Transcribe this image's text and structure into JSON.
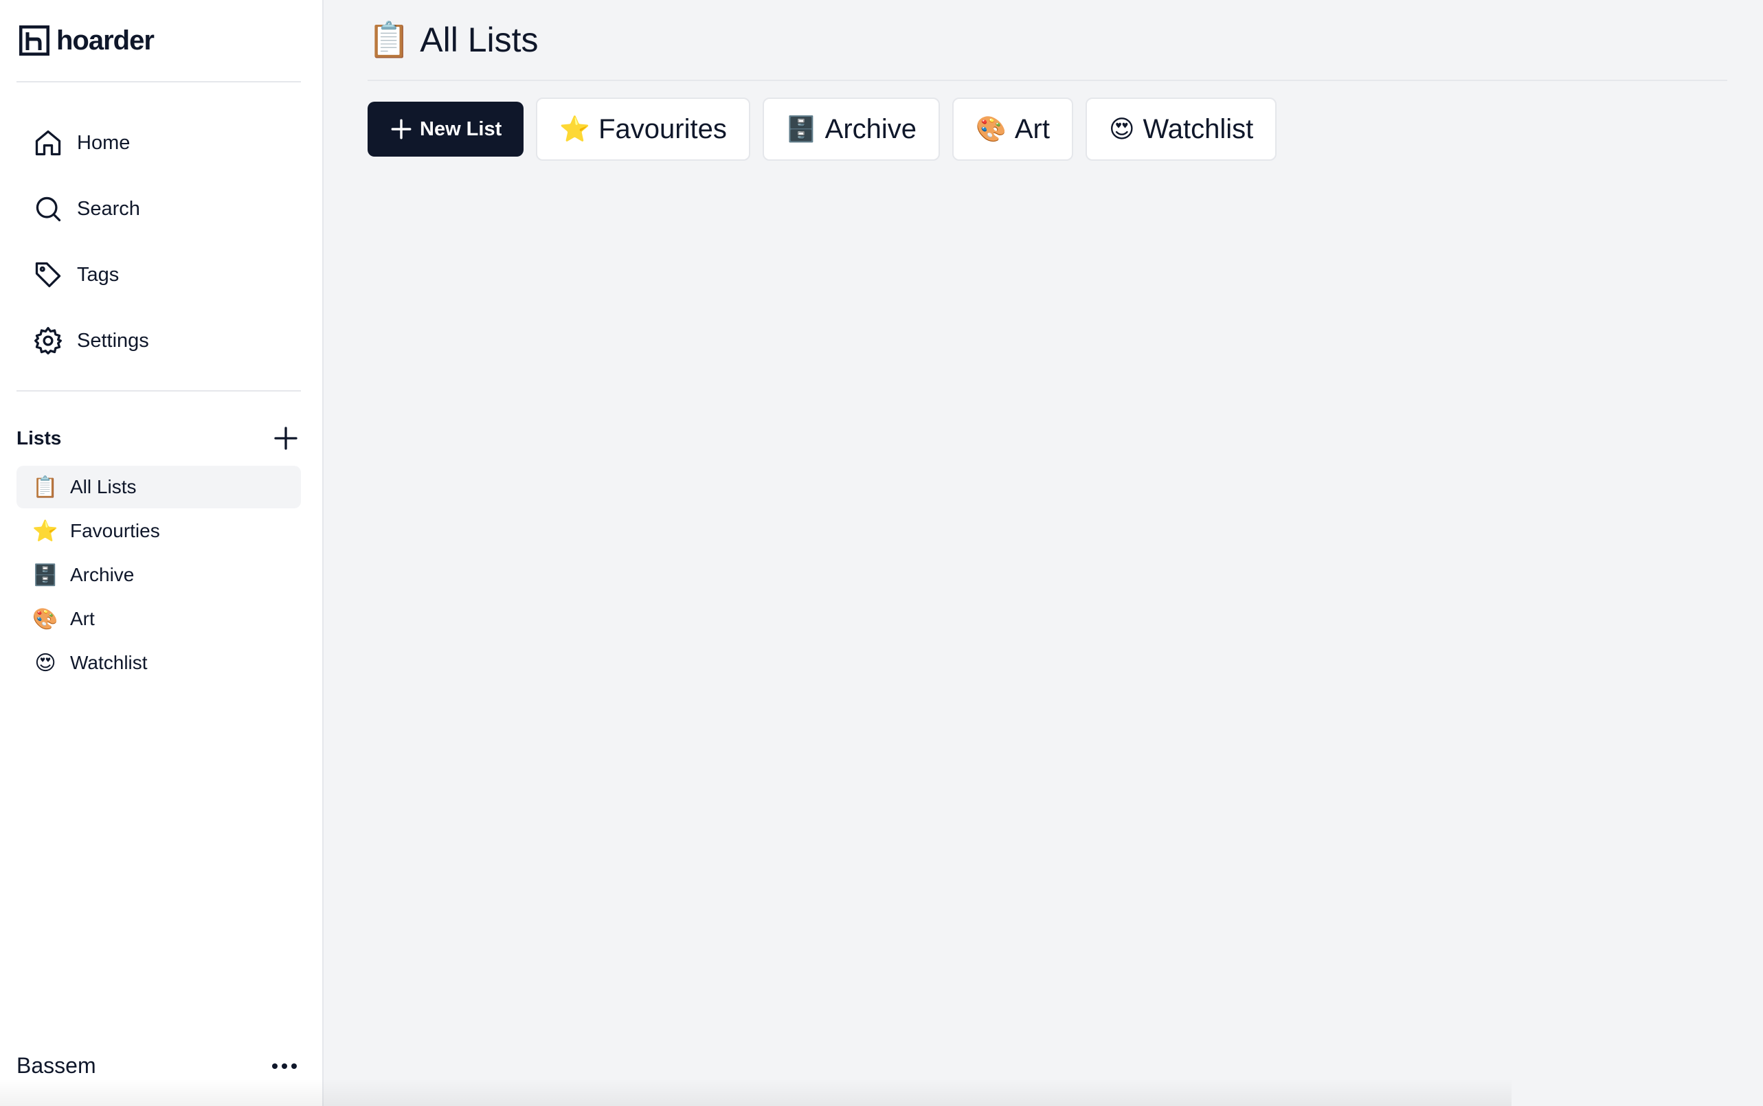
{
  "app": {
    "name": "hoarder"
  },
  "nav": [
    {
      "label": "Home",
      "icon": "home-icon"
    },
    {
      "label": "Search",
      "icon": "search-icon"
    },
    {
      "label": "Tags",
      "icon": "tag-icon"
    },
    {
      "label": "Settings",
      "icon": "gear-icon"
    }
  ],
  "lists": {
    "title": "Lists",
    "items": [
      {
        "emoji": "📋",
        "label": "All Lists",
        "active": true
      },
      {
        "emoji": "⭐️",
        "label": "Favourties"
      },
      {
        "emoji": "🗄️",
        "label": "Archive"
      },
      {
        "emoji": "🎨",
        "label": "Art"
      },
      {
        "emoji": "😍",
        "label": "Watchlist"
      }
    ]
  },
  "user": {
    "name": "Bassem"
  },
  "page": {
    "emoji": "📋",
    "title": "All Lists"
  },
  "toolbar": {
    "new_list_label": "New List",
    "chips": [
      {
        "emoji": "⭐️",
        "label": "Favourites"
      },
      {
        "emoji": "🗄️",
        "label": "Archive"
      },
      {
        "emoji": "🎨",
        "label": "Art"
      },
      {
        "emoji": "😍",
        "label": "Watchlist"
      }
    ]
  },
  "colors": {
    "primary": "#0f172a",
    "background": "#f3f4f6",
    "sidebar": "#ffffff",
    "border": "#e5e7eb"
  }
}
